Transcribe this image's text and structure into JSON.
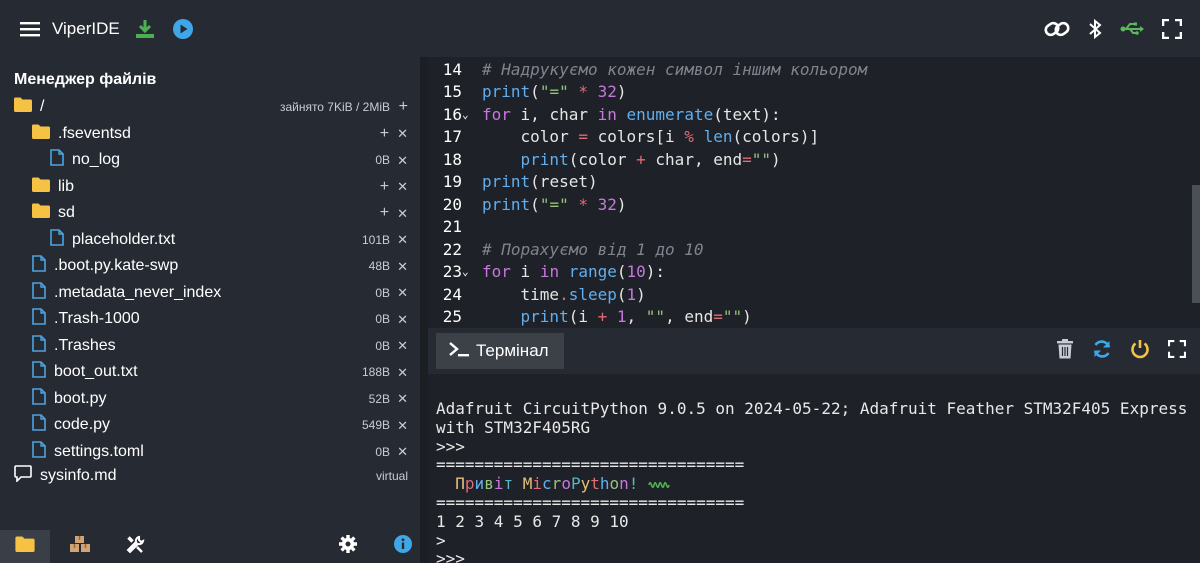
{
  "header": {
    "title": "ViperIDE",
    "accent_download": "#4caf50",
    "accent_run": "#3fa7e8",
    "accent_usb": "#5cb85c"
  },
  "file_manager": {
    "title": "Менеджер файлів",
    "root": {
      "name": "/",
      "usage": "зайнято 7KiB / 2MiB"
    },
    "items": [
      {
        "type": "folder",
        "indent": 1,
        "name": ".fseventsd"
      },
      {
        "type": "file",
        "indent": 2,
        "name": "no_log",
        "size": "0B"
      },
      {
        "type": "folder",
        "indent": 1,
        "name": "lib"
      },
      {
        "type": "folder",
        "indent": 1,
        "name": "sd"
      },
      {
        "type": "file",
        "indent": 2,
        "name": "placeholder.txt",
        "size": "101B"
      },
      {
        "type": "file",
        "indent": 1,
        "name": ".boot.py.kate-swp",
        "size": "48B"
      },
      {
        "type": "file",
        "indent": 1,
        "name": ".metadata_never_index",
        "size": "0B"
      },
      {
        "type": "file",
        "indent": 1,
        "name": ".Trash-1000",
        "size": "0B"
      },
      {
        "type": "file",
        "indent": 1,
        "name": ".Trashes",
        "size": "0B"
      },
      {
        "type": "file",
        "indent": 1,
        "name": "boot_out.txt",
        "size": "188B"
      },
      {
        "type": "file",
        "indent": 1,
        "name": "boot.py",
        "size": "52B"
      },
      {
        "type": "file",
        "indent": 1,
        "name": "code.py",
        "size": "549B"
      },
      {
        "type": "file",
        "indent": 1,
        "name": "settings.toml",
        "size": "0B"
      }
    ],
    "virtual": {
      "name": "sysinfo.md",
      "label": "virtual"
    }
  },
  "editor": {
    "lines": [
      {
        "n": "14",
        "fold": false,
        "tokens": [
          [
            "cm",
            "# Надрукуємо кожен символ іншим кольором"
          ]
        ]
      },
      {
        "n": "15",
        "fold": false,
        "tokens": [
          [
            "fn",
            "print"
          ],
          [
            "plain",
            "("
          ],
          [
            "str",
            "\"=\""
          ],
          [
            "plain",
            " "
          ],
          [
            "op",
            "*"
          ],
          [
            "plain",
            " "
          ],
          [
            "kw",
            "32"
          ],
          [
            "plain",
            ")"
          ]
        ]
      },
      {
        "n": "16",
        "fold": true,
        "tokens": [
          [
            "kw",
            "for"
          ],
          [
            "plain",
            " i, char "
          ],
          [
            "kw",
            "in"
          ],
          [
            "plain",
            " "
          ],
          [
            "fn",
            "enumerate"
          ],
          [
            "plain",
            "(text):"
          ]
        ]
      },
      {
        "n": "17",
        "fold": false,
        "tokens": [
          [
            "plain",
            "    color "
          ],
          [
            "op",
            "="
          ],
          [
            "plain",
            " colors[i "
          ],
          [
            "op",
            "%"
          ],
          [
            "plain",
            " "
          ],
          [
            "fn",
            "len"
          ],
          [
            "plain",
            "(colors)]"
          ]
        ]
      },
      {
        "n": "18",
        "fold": false,
        "tokens": [
          [
            "plain",
            "    "
          ],
          [
            "fn",
            "print"
          ],
          [
            "plain",
            "(color "
          ],
          [
            "op",
            "+"
          ],
          [
            "plain",
            " char, end"
          ],
          [
            "op",
            "="
          ],
          [
            "str",
            "\"\""
          ],
          [
            "plain",
            ")"
          ]
        ]
      },
      {
        "n": "19",
        "fold": false,
        "tokens": [
          [
            "fn",
            "print"
          ],
          [
            "plain",
            "(reset)"
          ]
        ]
      },
      {
        "n": "20",
        "fold": false,
        "tokens": [
          [
            "fn",
            "print"
          ],
          [
            "plain",
            "("
          ],
          [
            "str",
            "\"=\""
          ],
          [
            "plain",
            " "
          ],
          [
            "op",
            "*"
          ],
          [
            "plain",
            " "
          ],
          [
            "kw",
            "32"
          ],
          [
            "plain",
            ")"
          ]
        ]
      },
      {
        "n": "21",
        "fold": false,
        "tokens": []
      },
      {
        "n": "22",
        "fold": false,
        "tokens": [
          [
            "cm",
            "# Порахуємо від 1 до 10"
          ]
        ]
      },
      {
        "n": "23",
        "fold": true,
        "tokens": [
          [
            "kw",
            "for"
          ],
          [
            "plain",
            " i "
          ],
          [
            "kw",
            "in"
          ],
          [
            "plain",
            " "
          ],
          [
            "fn",
            "range"
          ],
          [
            "plain",
            "("
          ],
          [
            "kw",
            "10"
          ],
          [
            "plain",
            "):"
          ]
        ]
      },
      {
        "n": "24",
        "fold": false,
        "tokens": [
          [
            "plain",
            "    time"
          ],
          [
            "op",
            "."
          ],
          [
            "fn",
            "sleep"
          ],
          [
            "plain",
            "("
          ],
          [
            "kw",
            "1"
          ],
          [
            "plain",
            ")"
          ]
        ]
      },
      {
        "n": "25",
        "fold": false,
        "tokens": [
          [
            "plain",
            "    "
          ],
          [
            "fn",
            "print"
          ],
          [
            "plain",
            "(i "
          ],
          [
            "op",
            "+"
          ],
          [
            "plain",
            " "
          ],
          [
            "kw",
            "1"
          ],
          [
            "plain",
            ", "
          ],
          [
            "str",
            "\"\""
          ],
          [
            "plain",
            ", end"
          ],
          [
            "op",
            "="
          ],
          [
            "str",
            "\"\""
          ],
          [
            "plain",
            ")"
          ]
        ]
      }
    ]
  },
  "terminal": {
    "tab_label": "Термінал",
    "lines": [
      "Adafruit CircuitPython 9.0.5 on 2024-05-22; Adafruit Feather STM32F405 Express",
      "with STM32F405RG",
      ">>>",
      "================================",
      "",
      "================================",
      "1 2 3 4 5 6 7 8 9 10",
      ">",
      ">>>"
    ],
    "colored_line": [
      [
        "  ",
        "#e8e8e8"
      ],
      [
        "П",
        "#e5c07b"
      ],
      [
        "р",
        "#e06c75"
      ],
      [
        "и",
        "#61afef"
      ],
      [
        "в",
        "#98c379"
      ],
      [
        "і",
        "#c678dd"
      ],
      [
        "т",
        "#56b6c2"
      ],
      [
        " ",
        "#e8e8e8"
      ],
      [
        "M",
        "#e5c07b"
      ],
      [
        "i",
        "#e06c75"
      ],
      [
        "c",
        "#61afef"
      ],
      [
        "r",
        "#98c379"
      ],
      [
        "o",
        "#c678dd"
      ],
      [
        "P",
        "#56b6c2"
      ],
      [
        "y",
        "#e5c07b"
      ],
      [
        "t",
        "#e06c75"
      ],
      [
        "h",
        "#61afef"
      ],
      [
        "o",
        "#98c379"
      ],
      [
        "n",
        "#c678dd"
      ],
      [
        "!",
        "#56b6c2"
      ],
      [
        " ",
        "#e8e8e8"
      ]
    ]
  }
}
